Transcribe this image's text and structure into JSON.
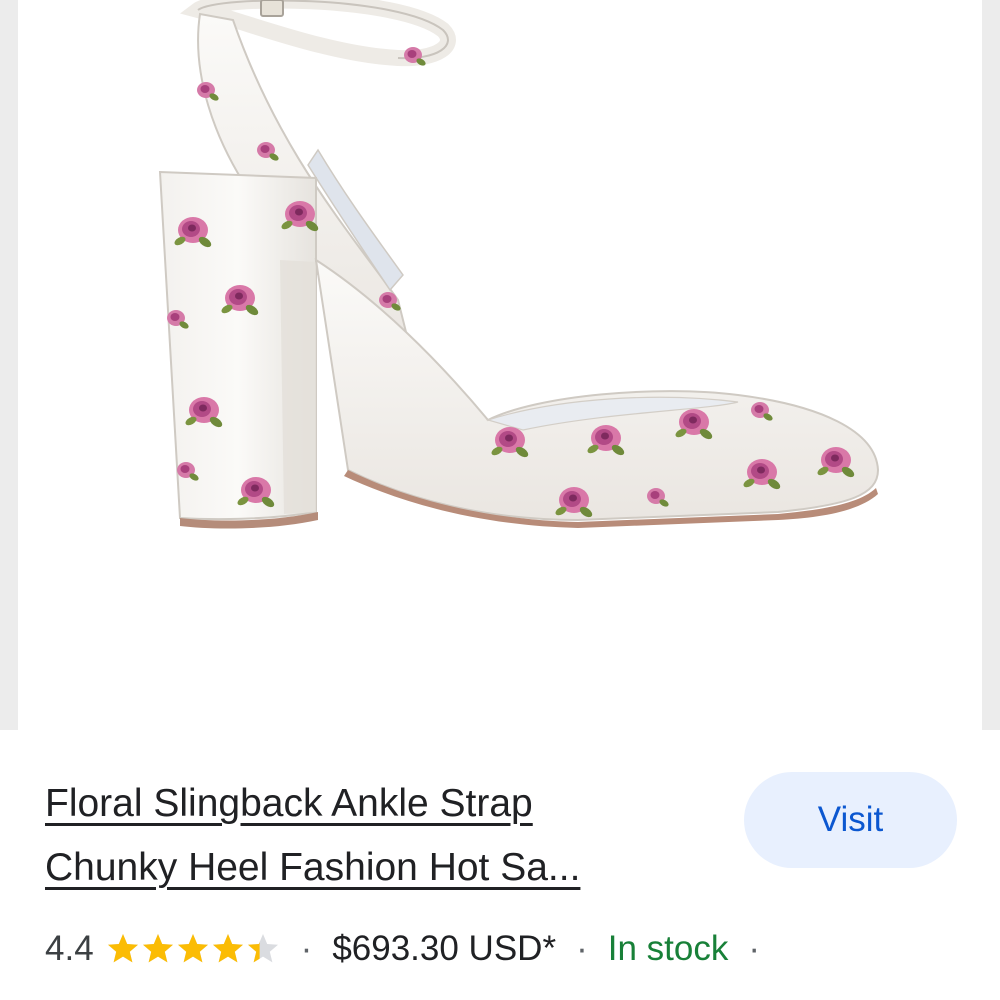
{
  "product": {
    "image_alt": "Floral print block-heel slingback pump",
    "title_line1": "Floral Slingback Ankle Strap",
    "title_line2": "Chunky Heel Fashion Hot Sa...",
    "visit_label": "Visit",
    "rating": "4.4",
    "rating_value": 4.4,
    "rating_max": 5,
    "separator": "·",
    "price": "$693.30 USD*",
    "availability": "In stock",
    "colors": {
      "star": "#fbbc04",
      "star_empty": "#dadce0",
      "link": "#0b57d0",
      "in_stock": "#188038"
    }
  }
}
